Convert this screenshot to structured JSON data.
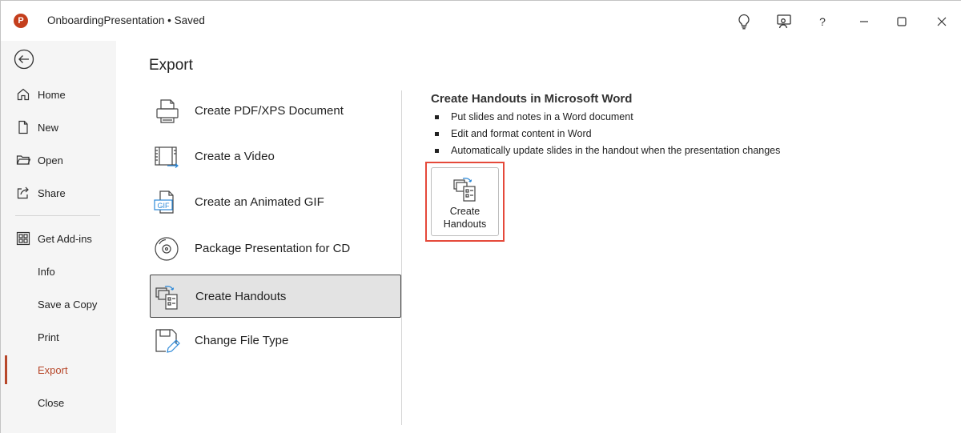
{
  "titlebar": {
    "app_logo": "P",
    "title": "OnboardingPresentation • Saved",
    "icons": [
      "lightbulb-icon",
      "coauthor-icon",
      "help-icon",
      "minimize-icon",
      "maximize-icon",
      "close-icon"
    ],
    "help_label": "?"
  },
  "sidebar": {
    "items": [
      {
        "label": "Home",
        "icon": "home-icon"
      },
      {
        "label": "New",
        "icon": "new-document-icon"
      },
      {
        "label": "Open",
        "icon": "folder-icon"
      },
      {
        "label": "Share",
        "icon": "share-icon"
      },
      {
        "label": "Get Add-ins",
        "icon": "add-ins-icon"
      },
      {
        "label": "Info"
      },
      {
        "label": "Save a Copy"
      },
      {
        "label": "Print"
      },
      {
        "label": "Export",
        "active": true
      },
      {
        "label": "Close"
      }
    ]
  },
  "main": {
    "title": "Export",
    "options": [
      {
        "label": "Create PDF/XPS Document",
        "icon": "pdf-printer-icon"
      },
      {
        "label": "Create a Video",
        "icon": "video-film-icon"
      },
      {
        "label": "Create an Animated GIF",
        "icon": "gif-icon",
        "icon_text": "GIF"
      },
      {
        "label": "Package Presentation for CD",
        "icon": "cd-icon"
      },
      {
        "label": "Create Handouts",
        "icon": "handouts-icon",
        "selected": true
      },
      {
        "label": "Change File Type",
        "icon": "change-file-type-icon"
      }
    ],
    "detail": {
      "title": "Create Handouts in Microsoft Word",
      "bullets": [
        "Put slides and notes in a Word document",
        "Edit and format content in Word",
        "Automatically update slides in the handout when the presentation changes"
      ],
      "button": {
        "line1": "Create",
        "line2": "Handouts",
        "icon": "handouts-icon"
      }
    }
  },
  "colors": {
    "accent": "#b7472a",
    "highlight": "#e5493a",
    "logo": "#c43e1c",
    "sidebar_bg": "#f5f5f5",
    "selected_bg": "#e3e3e3"
  }
}
